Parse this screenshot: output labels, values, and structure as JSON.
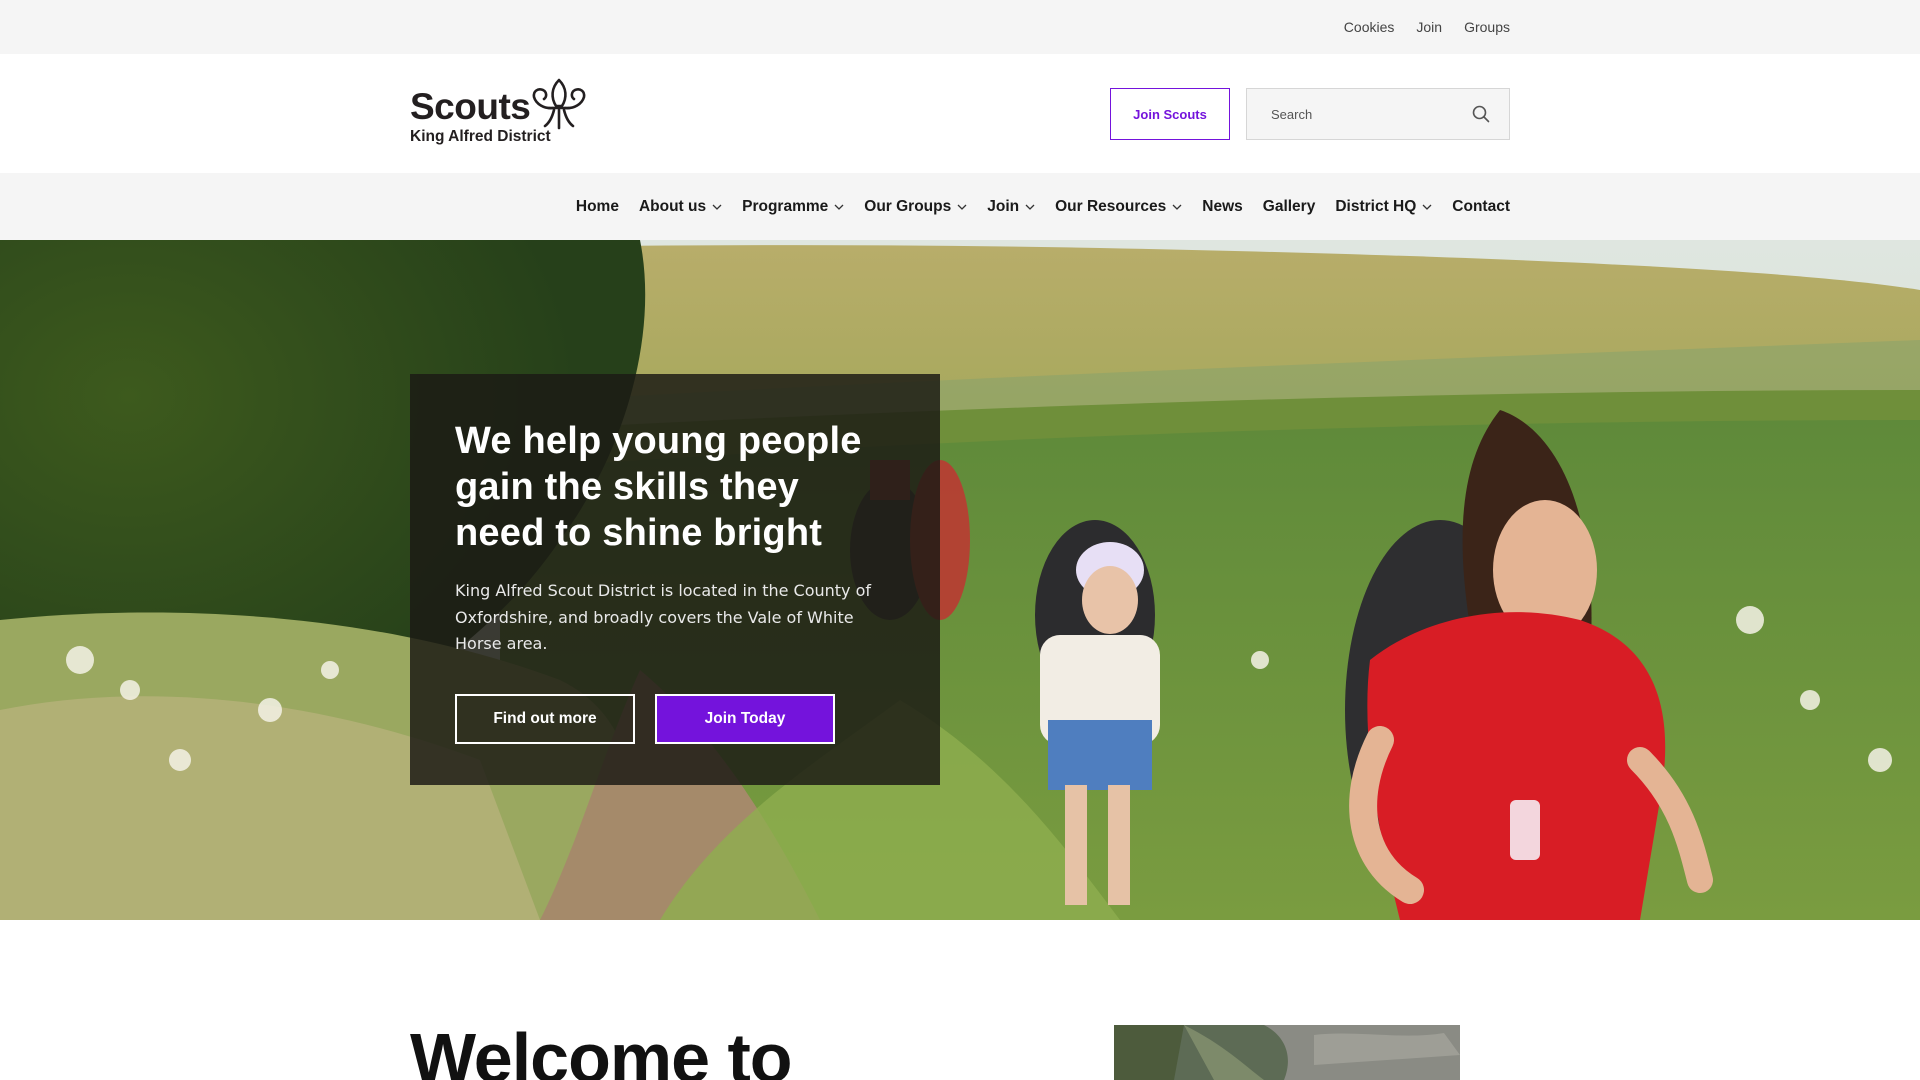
{
  "utility_nav": {
    "links": [
      "Cookies",
      "Join",
      "Groups"
    ]
  },
  "header": {
    "logo": {
      "wordmark": "Scouts",
      "district": "King Alfred District",
      "icon": "fleur-de-lis-icon"
    },
    "join_button": "Join Scouts",
    "search": {
      "placeholder": "Search",
      "value": "",
      "icon": "search-icon"
    }
  },
  "nav": {
    "items": [
      {
        "label": "Home",
        "dropdown": false
      },
      {
        "label": "About us",
        "dropdown": true
      },
      {
        "label": "Programme",
        "dropdown": true
      },
      {
        "label": "Our Groups",
        "dropdown": true
      },
      {
        "label": "Join",
        "dropdown": true
      },
      {
        "label": "Our Resources",
        "dropdown": true
      },
      {
        "label": "News",
        "dropdown": false
      },
      {
        "label": "Gallery",
        "dropdown": false
      },
      {
        "label": "District HQ",
        "dropdown": true
      },
      {
        "label": "Contact",
        "dropdown": false
      }
    ]
  },
  "hero": {
    "title": "We help young people gain the skills they need to shine bright",
    "text": "King Alfred Scout District is located in the County of Oxfordshire, and broadly covers the Vale of White Horse area.",
    "buttons": {
      "secondary": "Find out more",
      "primary": "Join Today"
    }
  },
  "welcome": {
    "title": "Welcome to"
  },
  "colors": {
    "brand_purple": "#7413dc",
    "background_grey": "#f5f5f5"
  }
}
